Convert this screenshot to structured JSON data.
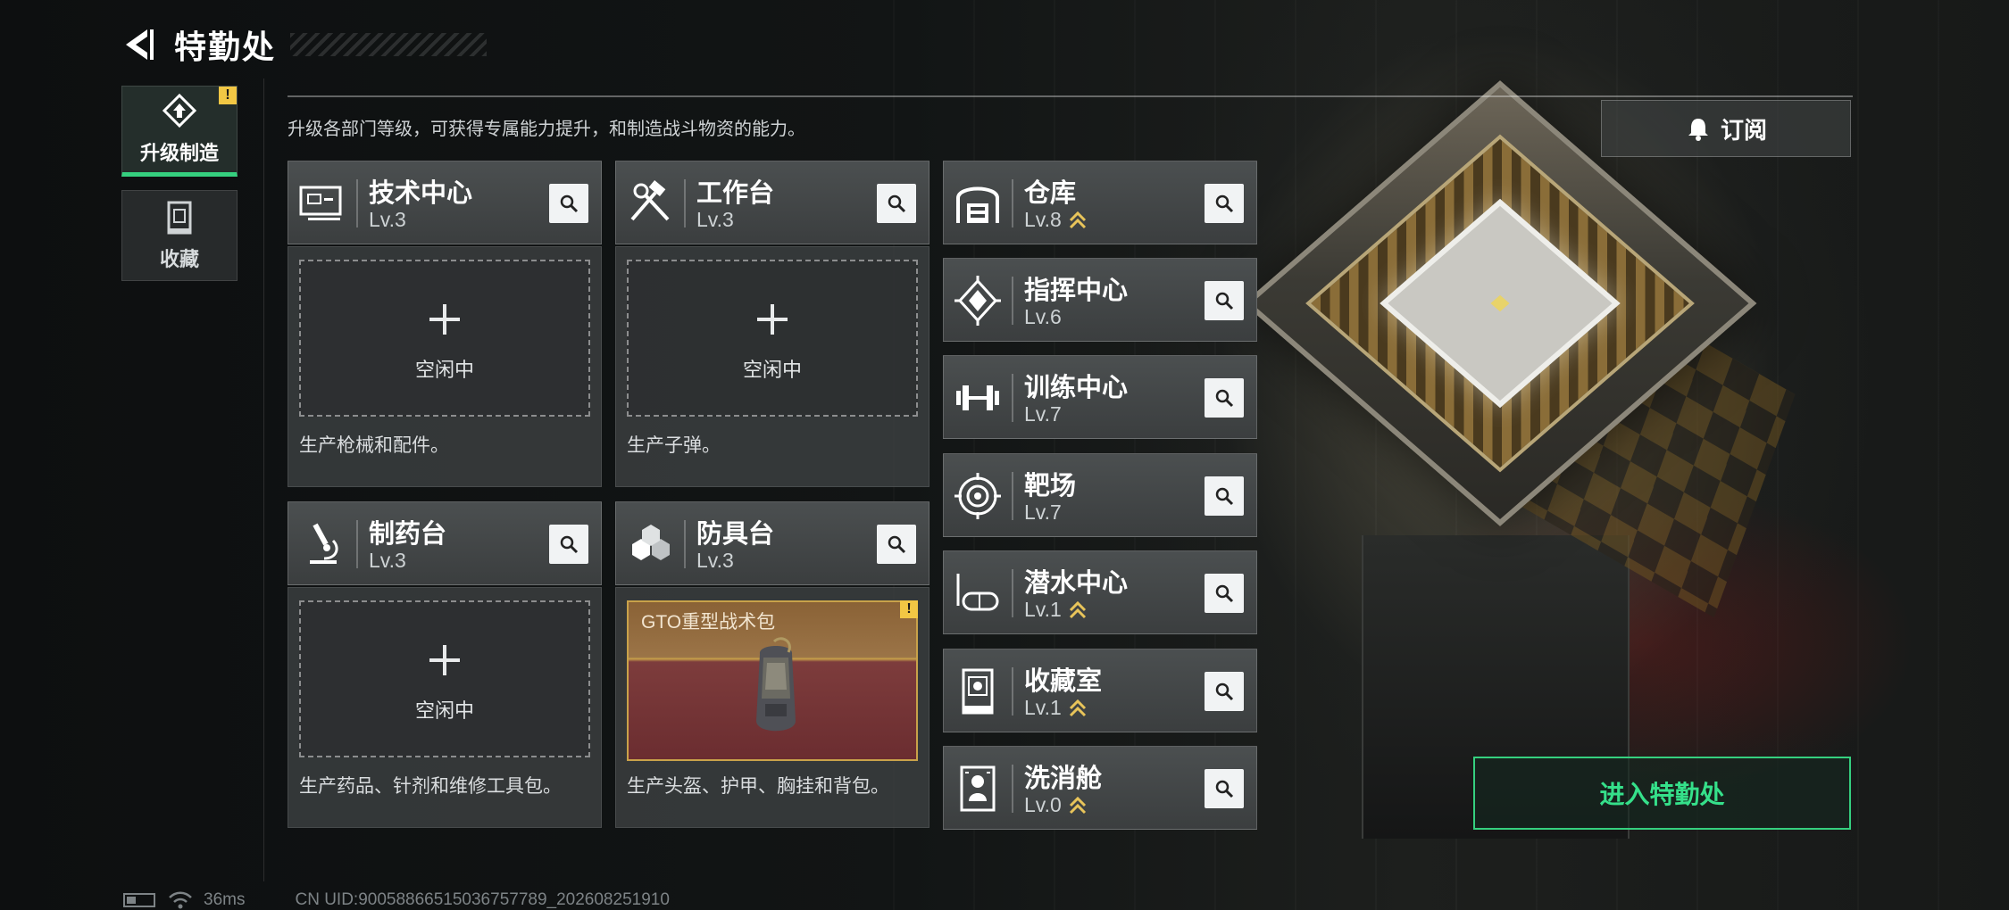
{
  "header": {
    "title": "特勤处"
  },
  "tabs": [
    {
      "label": "升级制造",
      "active": true,
      "alert": "!"
    },
    {
      "label": "收藏",
      "active": false
    }
  ],
  "description": "升级各部门等级，可获得专属能力提升，和制造战斗物资的能力。",
  "subscribe_label": "订阅",
  "production_cards": [
    {
      "name": "技术中心",
      "level": "Lv.3",
      "slot_text": "空闲中",
      "desc": "生产枪械和配件。"
    },
    {
      "name": "工作台",
      "level": "Lv.3",
      "slot_text": "空闲中",
      "desc": "生产子弹。"
    },
    {
      "name": "制药台",
      "level": "Lv.3",
      "slot_text": "空闲中",
      "desc": "生产药品、针剂和维修工具包。"
    },
    {
      "name": "防具台",
      "level": "Lv.3",
      "product_name": "GTO重型战术包",
      "alert": "!",
      "desc": "生产头盔、护甲、胸挂和背包。"
    }
  ],
  "departments": [
    {
      "name": "仓库",
      "level": "Lv.8",
      "upgradable": true
    },
    {
      "name": "指挥中心",
      "level": "Lv.6",
      "upgradable": false
    },
    {
      "name": "训练中心",
      "level": "Lv.7",
      "upgradable": false
    },
    {
      "name": "靶场",
      "level": "Lv.7",
      "upgradable": false
    },
    {
      "name": "潜水中心",
      "level": "Lv.1",
      "upgradable": true
    },
    {
      "name": "收藏室",
      "level": "Lv.1",
      "upgradable": true
    },
    {
      "name": "洗消舱",
      "level": "Lv.0",
      "upgradable": true
    }
  ],
  "enter_button": "进入特勤处",
  "status": {
    "ping": "36ms",
    "uid": "CN UID:9005886651503675778​9_202608251910"
  },
  "colors": {
    "accent_green": "#35d07f",
    "upgrade_gold": "#e8c45a",
    "alert_yellow": "#f2c744"
  }
}
